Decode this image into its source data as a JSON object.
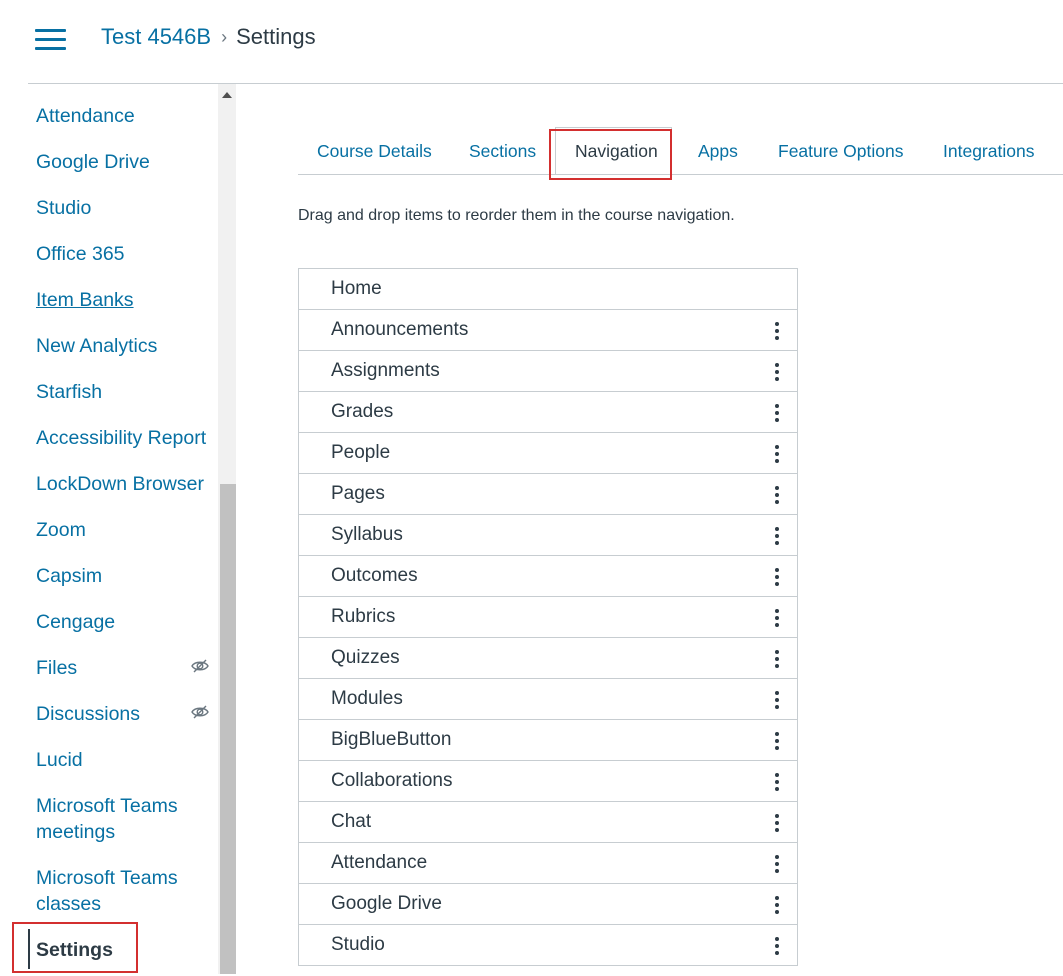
{
  "header": {
    "course": "Test 4546B",
    "separator": "›",
    "current": "Settings"
  },
  "leftnav": {
    "items": [
      {
        "label": "Attendance"
      },
      {
        "label": "Google Drive"
      },
      {
        "label": "Studio"
      },
      {
        "label": "Office 365"
      },
      {
        "label": "Item Banks"
      },
      {
        "label": "New Analytics"
      },
      {
        "label": "Starfish"
      },
      {
        "label": "Accessibility Report"
      },
      {
        "label": "LockDown Browser"
      },
      {
        "label": "Zoom"
      },
      {
        "label": "Capsim"
      },
      {
        "label": "Cengage"
      },
      {
        "label": "Files"
      },
      {
        "label": "Discussions"
      },
      {
        "label": "Lucid"
      },
      {
        "label": "Microsoft Teams meetings"
      },
      {
        "label": "Microsoft Teams classes"
      },
      {
        "label": "Settings"
      }
    ],
    "hidden_icon": "eye-slash-icon"
  },
  "tabs": [
    {
      "label": "Course Details"
    },
    {
      "label": "Sections"
    },
    {
      "label": "Navigation"
    },
    {
      "label": "Apps"
    },
    {
      "label": "Feature Options"
    },
    {
      "label": "Integrations"
    }
  ],
  "active_tab": "Navigation",
  "instructions": "Drag and drop items to reorder them in the course navigation.",
  "nav_list": [
    {
      "label": "Home"
    },
    {
      "label": "Announcements"
    },
    {
      "label": "Assignments"
    },
    {
      "label": "Grades"
    },
    {
      "label": "People"
    },
    {
      "label": "Pages"
    },
    {
      "label": "Syllabus"
    },
    {
      "label": "Outcomes"
    },
    {
      "label": "Rubrics"
    },
    {
      "label": "Quizzes"
    },
    {
      "label": "Modules"
    },
    {
      "label": "BigBlueButton"
    },
    {
      "label": "Collaborations"
    },
    {
      "label": "Chat"
    },
    {
      "label": "Attendance"
    },
    {
      "label": "Google Drive"
    },
    {
      "label": "Studio"
    }
  ],
  "colors": {
    "link": "#0770a3",
    "text": "#2d3b45",
    "highlight": "#d32f2f"
  }
}
